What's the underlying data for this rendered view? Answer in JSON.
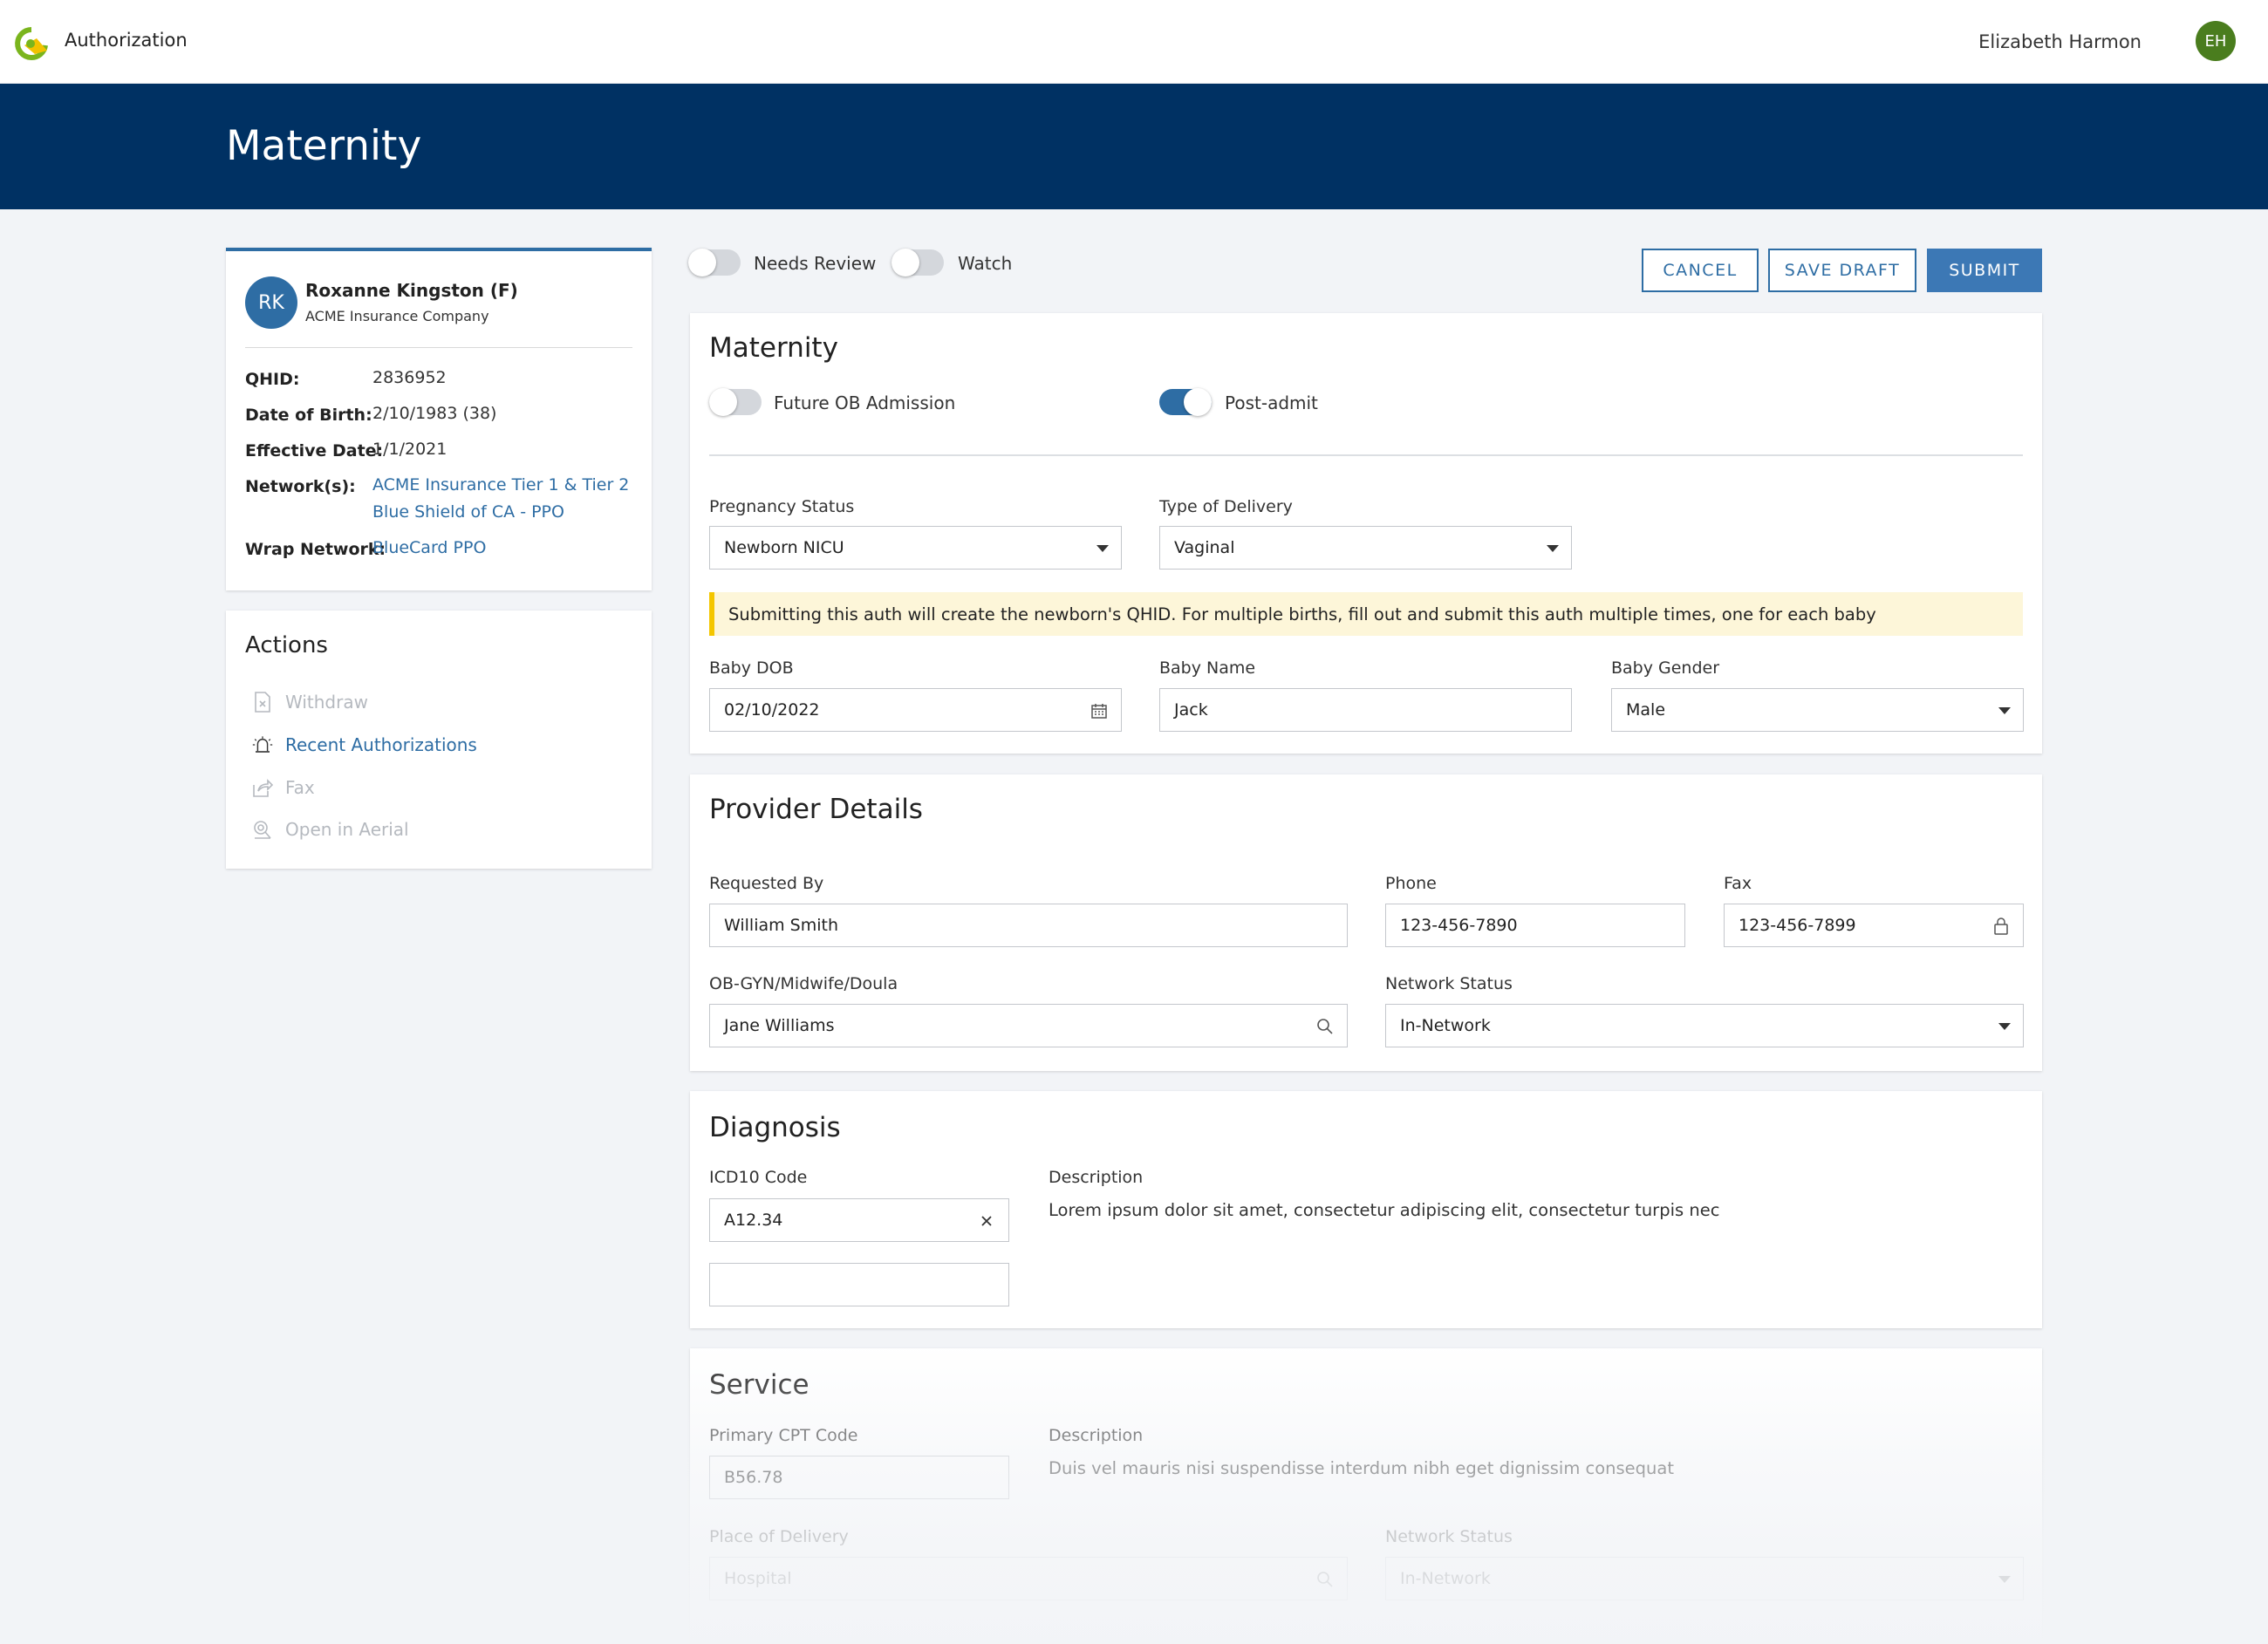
{
  "header": {
    "app_title": "Authorization",
    "user_name": "Elizabeth Harmon",
    "user_initials": "EH"
  },
  "banner": {
    "title": "Maternity"
  },
  "patient": {
    "initials": "RK",
    "name": "Roxanne Kingston (F)",
    "insurance": "ACME Insurance Company",
    "qhid_label": "QHID:",
    "qhid": "2836952",
    "dob_label": "Date of Birth:",
    "dob": "2/10/1983 (38)",
    "effective_label": "Effective Date:",
    "effective": "1/1/2021",
    "networks_label": "Network(s):",
    "networks": [
      "ACME Insurance Tier 1 & Tier 2",
      "Blue Shield of CA - PPO"
    ],
    "wrap_label": "Wrap Network:",
    "wrap": "BlueCard PPO"
  },
  "actions": {
    "title": "Actions",
    "items": [
      {
        "label": "Withdraw",
        "icon": "document-x-icon",
        "enabled": false
      },
      {
        "label": "Recent Authorizations",
        "icon": "alarm-light-icon",
        "enabled": true
      },
      {
        "label": "Fax",
        "icon": "share-icon",
        "enabled": false
      },
      {
        "label": "Open in Aerial",
        "icon": "aerial-icon",
        "enabled": false
      }
    ]
  },
  "toolbar": {
    "needs_review_label": "Needs Review",
    "needs_review_on": false,
    "watch_label": "Watch",
    "watch_on": false,
    "cancel_label": "CANCEL",
    "save_draft_label": "SAVE DRAFT",
    "submit_label": "SUBMIT"
  },
  "maternity": {
    "title": "Maternity",
    "future_ob_label": "Future OB Admission",
    "future_ob_on": false,
    "post_admit_label": "Post-admit",
    "post_admit_on": true,
    "pregnancy_status_label": "Pregnancy Status",
    "pregnancy_status": "Newborn NICU",
    "delivery_type_label": "Type of Delivery",
    "delivery_type": "Vaginal",
    "notice": "Submitting this auth will create the newborn's QHID. For multiple births, fill out and submit this auth multiple times, one for each baby",
    "baby_dob_label": "Baby DOB",
    "baby_dob": "02/10/2022",
    "baby_name_label": "Baby Name",
    "baby_name": "Jack",
    "baby_gender_label": "Baby Gender",
    "baby_gender": "Male"
  },
  "provider": {
    "title": "Provider Details",
    "requested_by_label": "Requested By",
    "requested_by": "William Smith",
    "phone_label": "Phone",
    "phone": "123-456-7890",
    "fax_label": "Fax",
    "fax": "123-456-7899",
    "obgyn_label": "OB-GYN/Midwife/Doula",
    "obgyn": "Jane Williams",
    "network_status_label": "Network Status",
    "network_status": "In-Network"
  },
  "diagnosis": {
    "title": "Diagnosis",
    "icd_label": "ICD10 Code",
    "icd": "A12.34",
    "description_label": "Description",
    "description": "Lorem ipsum dolor sit amet, consectetur adipiscing elit, consectetur turpis nec"
  },
  "service": {
    "title": "Service",
    "cpt_label": "Primary CPT Code",
    "cpt": "B56.78",
    "description_label": "Description",
    "description": "Duis vel mauris nisi suspendisse interdum nibh eget dignissim consequat",
    "place_label": "Place of Delivery",
    "place": "Hospital",
    "network_status_label": "Network Status",
    "network_status": "In-Network"
  },
  "colors": {
    "navy": "#003163",
    "accent": "#2e6da4",
    "notice_bg": "#fdf6d9",
    "notice_bar": "#f4c600",
    "avatar_green": "#4a7d1e"
  }
}
